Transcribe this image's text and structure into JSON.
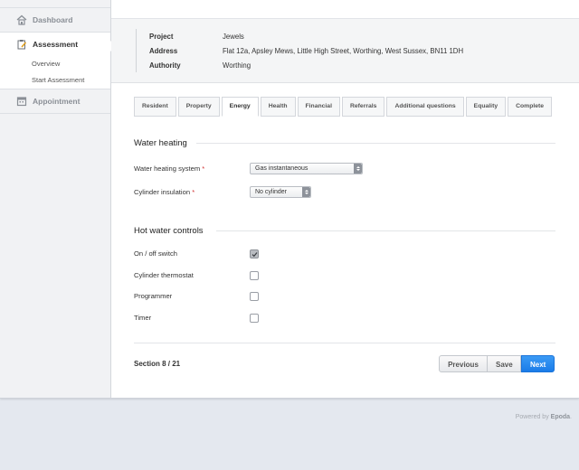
{
  "sidebar": {
    "dashboard": "Dashboard",
    "assessment": "Assessment",
    "overview": "Overview",
    "start_assessment": "Start Assessment",
    "appointment": "Appointment"
  },
  "info": {
    "project_label": "Project",
    "project_value": "Jewels",
    "address_label": "Address",
    "address_value": "Flat 12a, Apsley Mews, Little High Street, Worthing, West Sussex, BN11 1DH",
    "authority_label": "Authority",
    "authority_value": "Worthing"
  },
  "tabs": [
    "Resident",
    "Property",
    "Energy",
    "Health",
    "Financial",
    "Referrals",
    "Additional questions",
    "Equality",
    "Complete"
  ],
  "active_tab": "Energy",
  "water_heating": {
    "title": "Water heating",
    "system_label": "Water heating system",
    "system_value": "Gas instantaneous",
    "cylinder_label": "Cylinder insulation",
    "cylinder_value": "No cylinder",
    "required_mark": "*"
  },
  "hot_water": {
    "title": "Hot water controls",
    "items": [
      {
        "label": "On / off switch",
        "checked": true
      },
      {
        "label": "Cylinder thermostat",
        "checked": false
      },
      {
        "label": "Programmer",
        "checked": false
      },
      {
        "label": "Timer",
        "checked": false
      }
    ]
  },
  "footer": {
    "section": "Section 8 / 21",
    "previous": "Previous",
    "save": "Save",
    "next": "Next"
  },
  "powered": {
    "prefix": "Powered by ",
    "brand": "Epoda",
    "suffix": "."
  },
  "colors": {
    "accent": "#1a7be8",
    "required": "#d03030"
  }
}
